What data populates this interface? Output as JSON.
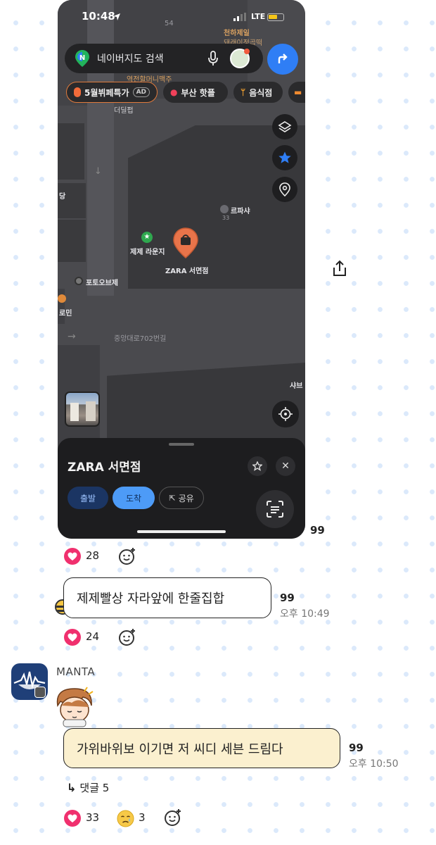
{
  "phone": {
    "status": {
      "time": "10:48",
      "network": "LTE"
    },
    "search": {
      "placeholder": "네이버지도 검색"
    },
    "chips": [
      "5월뷔페특가",
      "AD",
      "부산 핫플",
      "음식점"
    ],
    "map_labels": {
      "top_poi_1": "천하제일",
      "top_poi_2": "돼래이정곱떡",
      "poi_54": "54",
      "yeokjeon": "역전할머니맥주",
      "dilpub": "더딜펍",
      "dang": "당",
      "lepasha": "르파샤",
      "num_33": "33",
      "jeje_lounge": "제제 라운지",
      "zara_pin": "ZARA 서면점",
      "photo_obje": "포토오브제",
      "romin": "로민",
      "road": "중앙대로702번길",
      "shab": "샤브"
    },
    "sheet": {
      "place_name": "ZARA 서면점",
      "depart_label": "출발",
      "arrive_label": "도착",
      "share_label": "공유"
    }
  },
  "messages": [
    {
      "count": "99",
      "reactions": {
        "heart": "28"
      }
    },
    {
      "text": "제제빨상 자라앞에 한줄집합",
      "count": "99",
      "time": "오후 10:49",
      "reactions": {
        "heart": "24"
      }
    },
    {
      "author": "MANTA",
      "text": "가위바위보 이기면 저 씨디 세븐 드림다",
      "count": "99",
      "time": "오후 10:50",
      "reply_label": "댓글 5",
      "reactions": {
        "heart": "33",
        "sad": "3"
      }
    }
  ],
  "colors": {
    "heart": "#f0306e",
    "bubble_yellow": "#fbf0cf",
    "naver_blue": "#2f7ef5",
    "pin_orange": "#e8744a"
  }
}
